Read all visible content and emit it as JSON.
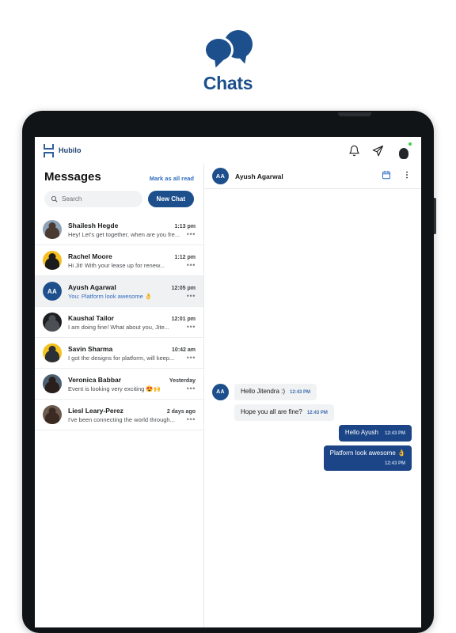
{
  "hero": {
    "title": "Chats",
    "logo_icon": "chat-bubbles-icon",
    "brand_color": "#1d4f8c"
  },
  "appbar": {
    "brand_name": "Hubilo",
    "brand_mark_icon": "hubilo-h-logo-icon",
    "icons": [
      {
        "name": "notification-bell-icon"
      },
      {
        "name": "send-paper-plane-icon"
      }
    ],
    "avatar": {
      "name": "user-avatar",
      "status": "online",
      "status_color": "#3ecf4a"
    }
  },
  "messages_panel": {
    "title": "Messages",
    "mark_all_read_label": "Mark as all read",
    "search": {
      "placeholder": "Search",
      "value": "",
      "icon": "search-icon"
    },
    "new_chat_label": "New Chat",
    "row_menu_glyph": "•••",
    "conversations": [
      {
        "name": "Shailesh Hegde",
        "time": "1:13 pm",
        "preview": "Hey! Let's get together, when are you fre...",
        "avatar_type": "photo",
        "avatar_bg": "#8ea3b8",
        "avatar_fg": "#4a3a30",
        "active": false
      },
      {
        "name": "Rachel Moore",
        "time": "1:12 pm",
        "preview": "Hi Jit! With your lease up for renew...",
        "avatar_type": "photo",
        "avatar_bg": "#f5bf21",
        "avatar_fg": "#1b1b1d",
        "active": false
      },
      {
        "name": "Ayush Agarwal",
        "time": "12:05 pm",
        "preview": "You: Platform look awesome 👌",
        "avatar_type": "initials",
        "initials": "AA",
        "avatar_bg": "#1d4f8c",
        "avatar_fg": "#ffffff",
        "active": true
      },
      {
        "name": "Kaushal Tailor",
        "time": "12:01 pm",
        "preview": "I am doing fine! What about you, Jite...",
        "avatar_type": "photo",
        "avatar_bg": "#1d1f21",
        "avatar_fg": "#4c4f53",
        "active": false
      },
      {
        "name": "Savin Sharma",
        "time": "10:42 am",
        "preview": "I got the designs for platform, will keep...",
        "avatar_type": "photo",
        "avatar_bg": "#f5c21d",
        "avatar_fg": "#2b2f36",
        "active": false
      },
      {
        "name": "Veronica Babbar",
        "time": "Yesterday",
        "preview": "Event is looking very exciting 😍🙌",
        "avatar_type": "photo",
        "avatar_bg": "#4a6072",
        "avatar_fg": "#2a1f1a",
        "active": false
      },
      {
        "name": "Liesl Leary-Perez",
        "time": "2 days ago",
        "preview": "I've been connecting the world through...",
        "avatar_type": "photo",
        "avatar_bg": "#6b5a4e",
        "avatar_fg": "#3a2a22",
        "active": false
      }
    ]
  },
  "chat_panel": {
    "header": {
      "name": "Ayush Agarwal",
      "initials": "AA",
      "avatar_bg": "#1d4f8c",
      "icons": [
        {
          "name": "calendar-icon"
        },
        {
          "name": "more-vertical-icon"
        }
      ]
    },
    "messages": [
      {
        "direction": "in",
        "text": "Hello Jitendra :)",
        "time": "12:43 PM",
        "show_avatar": true,
        "initials": "AA",
        "layout": "inline"
      },
      {
        "direction": "in",
        "text": "Hope you all are fine?",
        "time": "12:43 PM",
        "show_avatar": false,
        "initials": "AA",
        "layout": "inline"
      },
      {
        "direction": "out",
        "text": "Hello Ayush",
        "time": "12:43 PM",
        "show_avatar": false,
        "initials": "",
        "layout": "inline"
      },
      {
        "direction": "out",
        "text": "Platform look awesome 👌",
        "time": "12:43 PM",
        "show_avatar": false,
        "initials": "",
        "layout": "stacked"
      }
    ],
    "bubble_in_bg": "#f1f2f4",
    "bubble_out_bg": "#1b4586"
  }
}
